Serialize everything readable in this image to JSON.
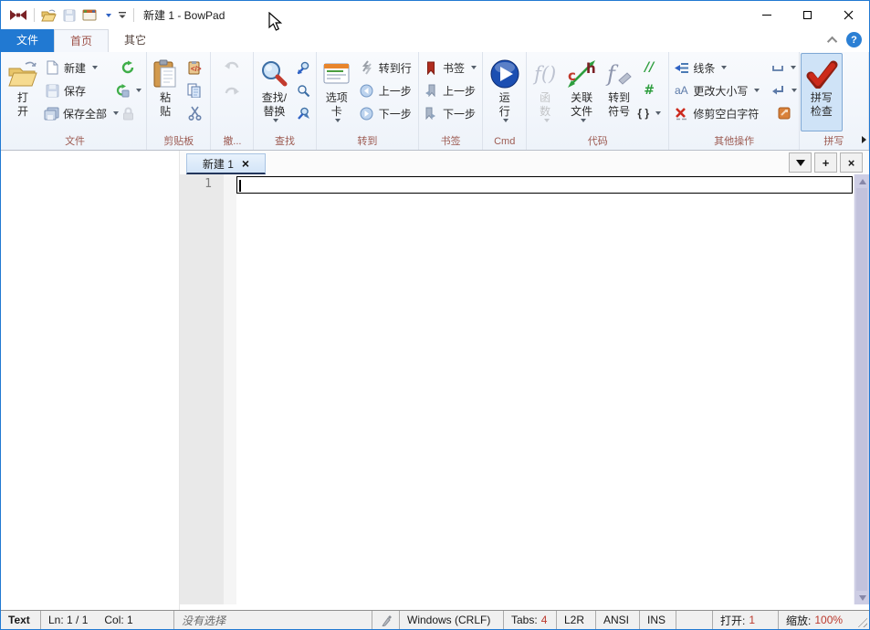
{
  "window": {
    "title": "新建 1 - BowPad"
  },
  "ribbon": {
    "tabs": {
      "file": "文件",
      "home": "首页",
      "other": "其它"
    },
    "help": "?",
    "groups": {
      "file": {
        "label": "文件",
        "open": "打\n开",
        "new_btn": "新建",
        "save": "保存",
        "save_all": "保存全部"
      },
      "clipboard": {
        "label": "剪贴板",
        "paste": "粘\n贴"
      },
      "undo": {
        "label": "撤..."
      },
      "find": {
        "label": "查找",
        "find_replace": "查找/\n替换"
      },
      "goto": {
        "label": "转到",
        "tab_options": "选项\n卡",
        "goto_line": "转到行",
        "prev": "上一步",
        "next": "下一步"
      },
      "bookmarks": {
        "label": "书签",
        "bookmark": "书签",
        "prev": "上一步",
        "next": "下一步"
      },
      "cmd": {
        "label": "Cmd",
        "run": "运\n行"
      },
      "code": {
        "label": "代码",
        "functions": "函\n数",
        "related_files": "关联\n文件",
        "goto_symbol": "转到\n符号"
      },
      "other": {
        "label": "其他操作",
        "lines": "线条",
        "change_case": "更改大小写",
        "trim_whitespace": "修剪空白字符"
      },
      "spell": {
        "label": "拼写",
        "spell_check": "拼写\n检查"
      }
    }
  },
  "tabbar": {
    "tab_title": "新建 1",
    "close_glyph": "×",
    "new_glyph": "+"
  },
  "editor": {
    "line_number": "1"
  },
  "statusbar": {
    "doc_type": "Text",
    "line_info": "Ln: 1 / 1",
    "col_info": "Col: 1",
    "selection": "没有选择",
    "eol": "Windows (CRLF)",
    "tabs_label": "Tabs:",
    "tabs_value": "4",
    "direction": "L2R",
    "encoding": "ANSI",
    "typing_mode": "INS",
    "open_label": "打开:",
    "open_value": "1",
    "zoom_label": "缩放:",
    "zoom_value": "100%"
  },
  "icons": {
    "bowpad-logo-icon": "dark-red bowtie",
    "open-folder-icon": "yellow open folder",
    "save-icon": "blue floppy disk",
    "recent-files-icon": "window with colored header",
    "qat-customize-icon": "small chevron with bar",
    "minimize-icon": "thin dash",
    "maximize-icon": "hollow square",
    "close-icon": "thin x",
    "collapse-ribbon-icon": "chevron up",
    "new-file-icon": "blank page",
    "save-all-icon": "stacked floppies",
    "reload-icon": "green circular arrow",
    "reload-encoding-icon": "green arrow with disk",
    "lock-icon": "gray padlock",
    "clipboard-paste-icon": "clipboard with white page",
    "paste-special-icon": "clipboard with code tag",
    "copy-icon": "two blue pages",
    "cut-icon": "scissors",
    "undo-icon": "curved arrow left",
    "redo-icon": "curved arrow right",
    "find-replace-icon": "magnifier with red handle",
    "find-next-icon": "small blue magnifier",
    "find-prev-icon": "small blue magnifier outline",
    "find-all-icon": "small blue magnifier flag",
    "tab-options-icon": "white card with colored lines",
    "goto-line-icon": "gray lightning",
    "prev-step-icon": "blue circle left arrow",
    "next-step-icon": "blue circle right arrow",
    "bookmark-icon": "red ribbon",
    "bookmark-prev-icon": "gray ribbon left",
    "bookmark-next-icon": "gray ribbon right",
    "run-icon": "glossy blue play button",
    "functions-glyph": "f()",
    "related-files-icon": "c h with green arrows",
    "goto-symbol-glyph": "f",
    "comment-glyph": "//",
    "uncomment-glyph": "#",
    "braces-glyph": "{ }",
    "lines-icon": "blue lines with left arrow",
    "change-case-glyph": "aA",
    "trim-icon": "red x over underscores",
    "whitespace-icon": "open bracket",
    "line-ending-icon": "return arrow",
    "explorer-icon": "orange square",
    "spellcheck-icon": "big red checkmark",
    "style-indicator-icon": "small gray pen"
  },
  "colors": {
    "accent_blue": "#2179d2",
    "ribbon_group_label": "#9d5b52",
    "active_tab_text": "#9d5148",
    "status_value_red": "#bb3a2e",
    "doc_tab_bg": "#d3e5f8",
    "scrollbar_track": "#cdcde4",
    "window_border": "#2179d2"
  }
}
